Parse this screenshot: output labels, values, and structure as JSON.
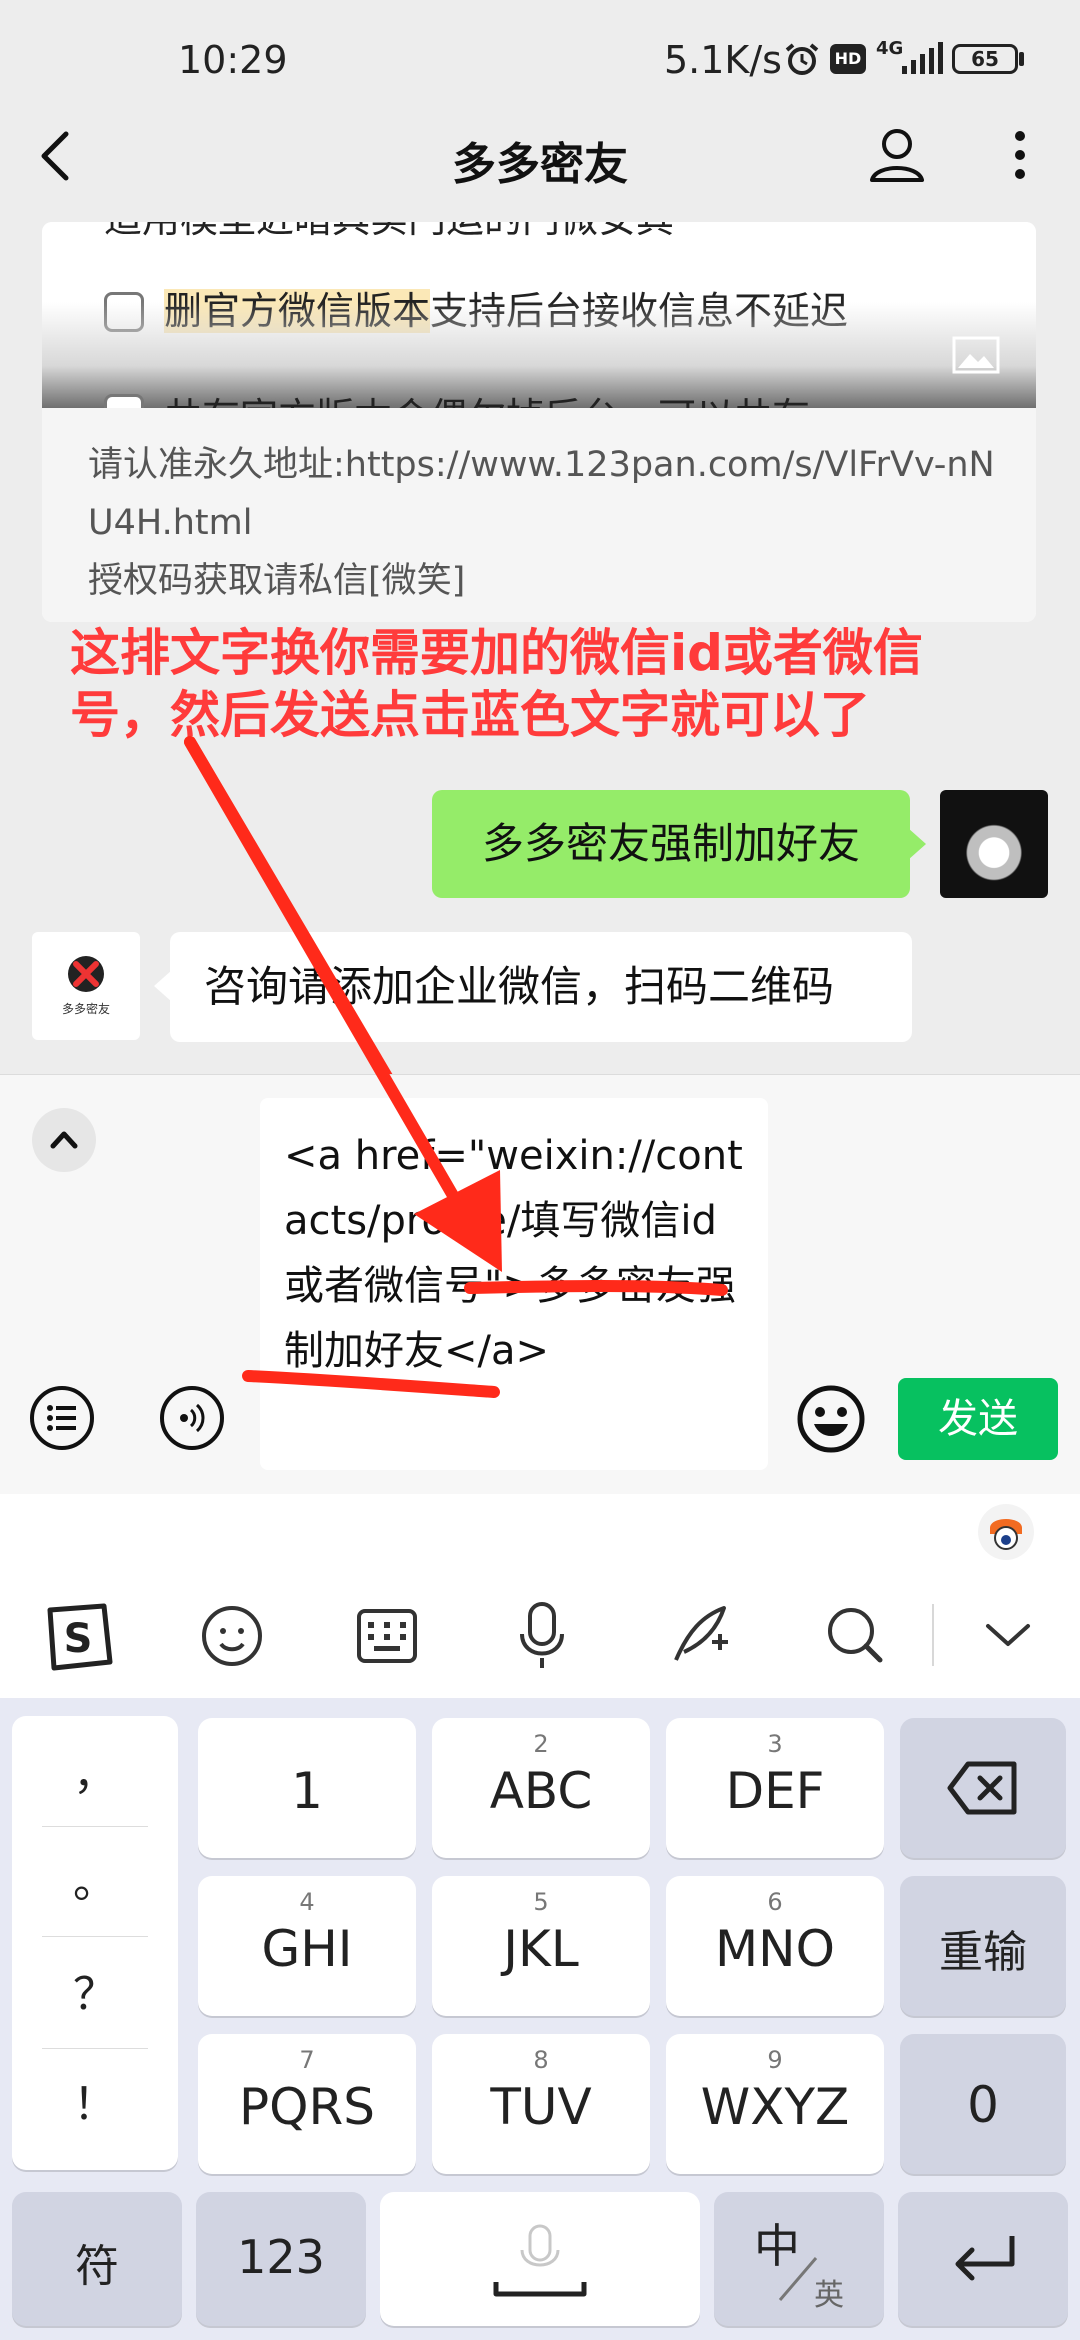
{
  "status_bar": {
    "time": "10:29",
    "net_speed": "5.1K/s",
    "hd_badge": "HD",
    "signal": "4G",
    "battery": "65"
  },
  "nav": {
    "title": "多多密友"
  },
  "chat": {
    "card_line_top": "适用模型近暗具实门运的门微安其",
    "card_item_1_highlight": "删官方微信版本",
    "card_item_1_rest": "支持后台接收信息不延迟",
    "card_item_2": "共存官方版本会偶尔掉后台，可以共存",
    "card_footer_line1": "请认准永久地址:https://www.123pan.com/s/VlFrVv-nNU4H.html",
    "card_footer_line2": "授权码获取请私信[微笑]",
    "annotation": "这排文字换你需要加的微信id或者微信号，然后发送点击蓝色文字就可以了",
    "my_message": "多多密友强制加好友",
    "bot_avatar_caption": "多多密友",
    "bot_message": "咨询请添加企业微信，扫码二维码"
  },
  "input": {
    "text": "<a href=\"weixin://contacts/profile/填写微信id或者微信号\">多多密友强制加好友</a>",
    "send_label": "发送"
  },
  "keyboard": {
    "punctuation": [
      "，",
      "。",
      "？",
      "！"
    ],
    "keys": [
      {
        "num": "",
        "label": "1"
      },
      {
        "num": "2",
        "label": "ABC"
      },
      {
        "num": "3",
        "label": "DEF"
      },
      {
        "num": "4",
        "label": "GHI"
      },
      {
        "num": "5",
        "label": "JKL"
      },
      {
        "num": "6",
        "label": "MNO"
      },
      {
        "num": "7",
        "label": "PQRS"
      },
      {
        "num": "8",
        "label": "TUV"
      },
      {
        "num": "9",
        "label": "WXYZ"
      }
    ],
    "reenter_label": "重输",
    "zero_label": "0",
    "symbols_label": "符",
    "numbers_label": "123",
    "lang_main": "中",
    "lang_sub": "英"
  },
  "colors": {
    "send_green": "#07c160",
    "my_bubble": "#95ec69",
    "annotation_red": "#ff3b3b",
    "highlight": "#fbe8b7"
  }
}
